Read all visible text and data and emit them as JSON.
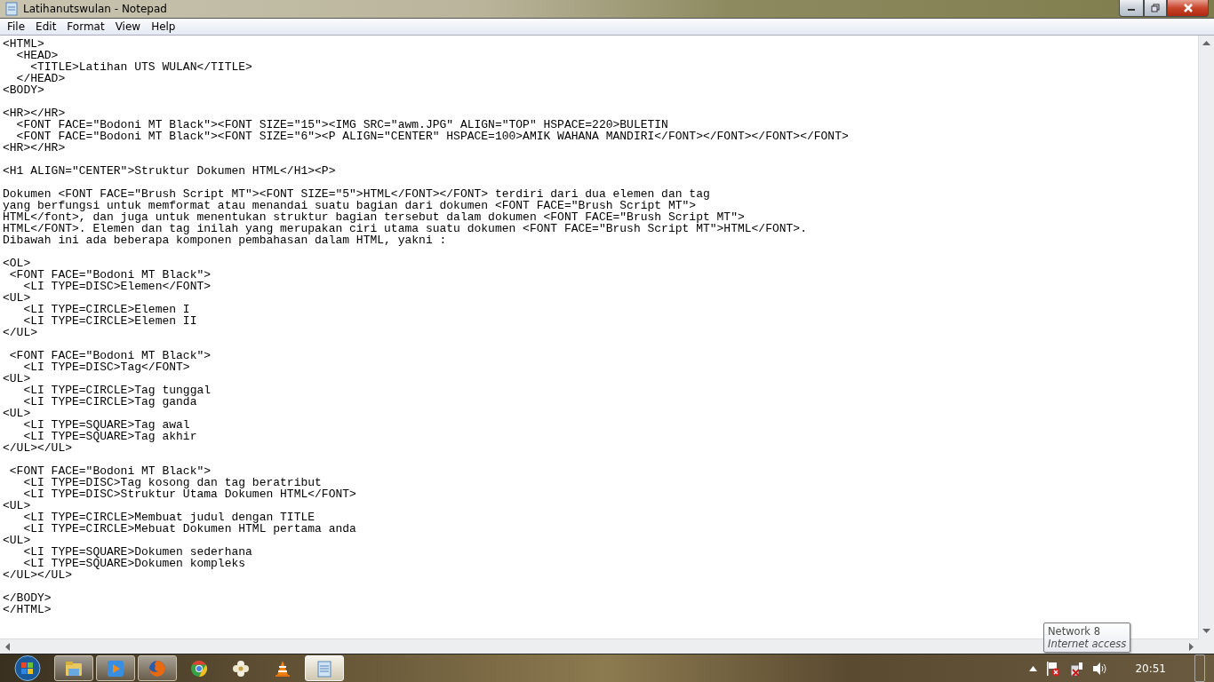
{
  "window": {
    "title": "Latihanutswulan - Notepad"
  },
  "menu": [
    "File",
    "Edit",
    "Format",
    "View",
    "Help"
  ],
  "document": {
    "blocks": [
      [
        "<HTML>",
        "  <HEAD>",
        "    <TITLE>Latihan UTS WULAN</TITLE>",
        "  </HEAD>",
        "<BODY>"
      ],
      [
        "<HR></HR>",
        "  <FONT FACE=\"Bodoni MT Black\"><FONT SIZE=\"15\"><IMG SRC=\"awm.JPG\" ALIGN=\"TOP\" HSPACE=220>BULETIN",
        "  <FONT FACE=\"Bodoni MT Black\"><FONT SIZE=\"6\"><P ALIGN=\"CENTER\" HSPACE=100>AMIK WAHANA MANDIRI</FONT></FONT></FONT></FONT>",
        "<HR></HR>"
      ],
      [
        "<H1 ALIGN=\"CENTER\">Struktur Dokumen HTML</H1><P>"
      ],
      [
        "Dokumen <FONT FACE=\"Brush Script MT\"><FONT SIZE=\"5\">HTML</FONT></FONT> terdiri dari dua elemen dan tag",
        "yang berfungsi untuk memformat atau menandai suatu bagian dari dokumen <FONT FACE=\"Brush Script MT\">",
        "HTML</font>, dan juga untuk menentukan struktur bagian tersebut dalam dokumen <FONT FACE=\"Brush Script MT\">",
        "HTML</FONT>. Elemen dan tag inilah yang merupakan ciri utama suatu dokumen <FONT FACE=\"Brush Script MT\">HTML</FONT>.",
        "Dibawah ini ada beberapa komponen pembahasan dalam HTML, yakni :"
      ],
      [
        "<OL>",
        " <FONT FACE=\"Bodoni MT Black\">",
        "   <LI TYPE=DISC>Elemen</FONT>",
        "<UL>",
        "   <LI TYPE=CIRCLE>Elemen I",
        "   <LI TYPE=CIRCLE>Elemen II",
        "</UL>"
      ],
      [
        " <FONT FACE=\"Bodoni MT Black\">",
        "   <LI TYPE=DISC>Tag</FONT>",
        "<UL>",
        "   <LI TYPE=CIRCLE>Tag tunggal",
        "   <LI TYPE=CIRCLE>Tag ganda",
        "<UL>",
        "   <LI TYPE=SQUARE>Tag awal",
        "   <LI TYPE=SQUARE>Tag akhir",
        "</UL></UL>"
      ],
      [
        " <FONT FACE=\"Bodoni MT Black\">",
        "   <LI TYPE=DISC>Tag kosong dan tag beratribut",
        "   <LI TYPE=DISC>Struktur Utama Dokumen HTML</FONT>",
        "<UL>",
        "   <LI TYPE=CIRCLE>Membuat judul dengan TITLE",
        "   <LI TYPE=CIRCLE>Mebuat Dokumen HTML pertama anda",
        "<UL>",
        "   <LI TYPE=SQUARE>Dokumen sederhana",
        "   <LI TYPE=SQUARE>Dokumen kompleks",
        "</UL></UL>"
      ],
      [
        "</BODY>",
        "</HTML>"
      ]
    ]
  },
  "tooltip": {
    "title": "Network 8",
    "subtitle": "Internet access"
  },
  "taskbar": {
    "items": [
      {
        "kind": "folder",
        "running": true,
        "selected": false
      },
      {
        "kind": "media",
        "running": true,
        "selected": false
      },
      {
        "kind": "firefox",
        "running": true,
        "selected": false
      },
      {
        "kind": "chrome",
        "running": false,
        "selected": false
      },
      {
        "kind": "flower",
        "running": false,
        "selected": false
      },
      {
        "kind": "cone",
        "running": false,
        "selected": false
      },
      {
        "kind": "notepad",
        "running": true,
        "selected": true
      }
    ],
    "clock": "20:51"
  }
}
